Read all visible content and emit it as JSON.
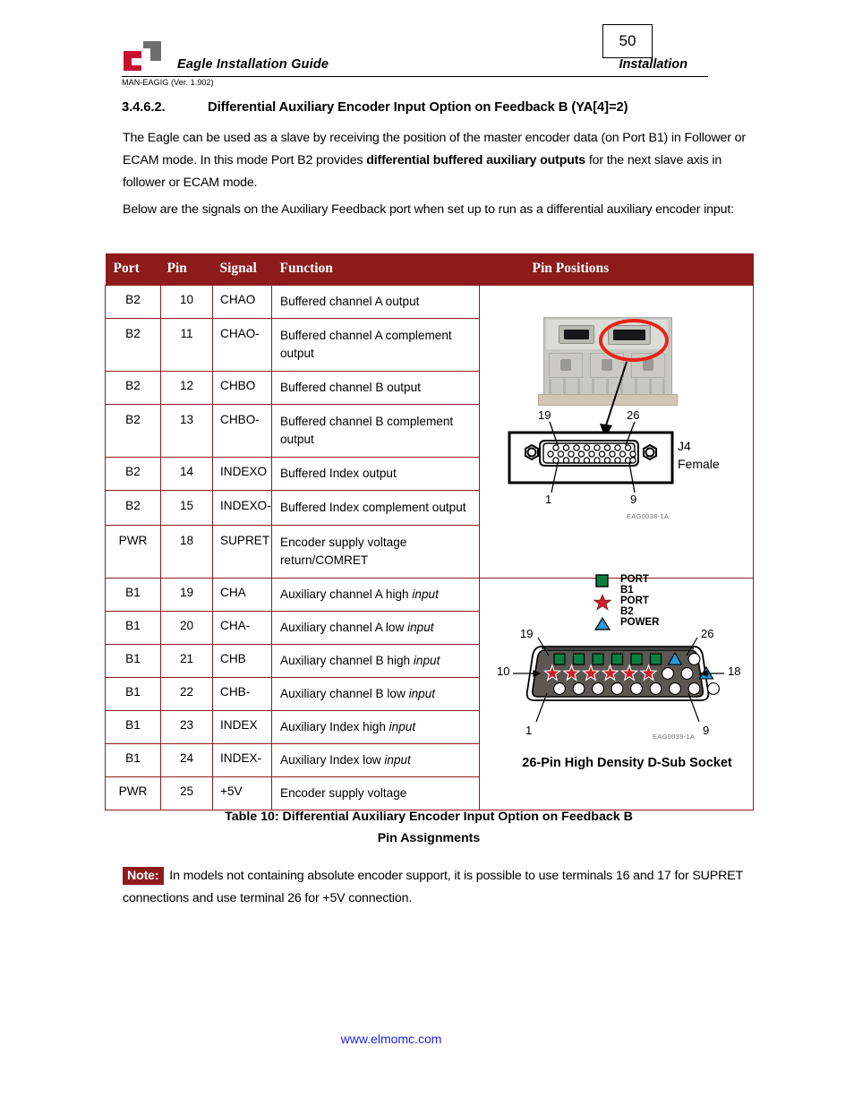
{
  "header": {
    "title": "Eagle Installation Guide",
    "doc_id": "MAN-EAGIG (Ver. 1.902)",
    "section": "Installation",
    "page_number": "50",
    "logo_name": "elmo-logo"
  },
  "section": {
    "number": "3.4.6.2.",
    "heading": "Differential Auxiliary Encoder Input Option on Feedback B (YA[4]=2)"
  },
  "paragraphs": {
    "p1_a": "The Eagle can be used as a slave by receiving the position of the master encoder data (on Port B1) in Follower or ECAM mode. In this mode Port B2 provides ",
    "p1_bold": "differential buffered auxiliary outputs",
    "p1_b": " for the next slave axis in follower or ECAM mode.",
    "p2": "Below are the signals on the Auxiliary Feedback port when set up to run as a differential auxiliary encoder input:"
  },
  "table": {
    "headers": {
      "port": "Port",
      "pin": "Pin",
      "signal": "Signal",
      "function": "Function",
      "pin_positions": "Pin Positions"
    },
    "header_bg": "#8E1B1B",
    "border_color": "#8E1B1B",
    "rows": [
      {
        "port": "B2",
        "pin": "10",
        "signal": "CHAO",
        "function": "Buffered channel A output",
        "italic": ""
      },
      {
        "port": "B2",
        "pin": "11",
        "signal": "CHAO-",
        "function": "Buffered channel A complement output",
        "italic": ""
      },
      {
        "port": "B2",
        "pin": "12",
        "signal": "CHBO",
        "function": "Buffered channel B output",
        "italic": ""
      },
      {
        "port": "B2",
        "pin": "13",
        "signal": "CHBO-",
        "function": "Buffered channel B complement output",
        "italic": ""
      },
      {
        "port": "B2",
        "pin": "14",
        "signal": "INDEXO",
        "function": "Buffered Index output",
        "italic": ""
      },
      {
        "port": "B2",
        "pin": "15",
        "signal": "INDEXO-",
        "function": "Buffered Index complement output",
        "italic": ""
      },
      {
        "port": "PWR",
        "pin": "18",
        "signal": "SUPRET",
        "function": "Encoder supply voltage return/COMRET",
        "italic": ""
      },
      {
        "port": "B1",
        "pin": "19",
        "signal": "CHA",
        "function": "Auxiliary channel A high ",
        "italic": "input"
      },
      {
        "port": "B1",
        "pin": "20",
        "signal": "CHA-",
        "function": "Auxiliary channel A low ",
        "italic": "input"
      },
      {
        "port": "B1",
        "pin": "21",
        "signal": "CHB",
        "function": "Auxiliary channel B high ",
        "italic": "input"
      },
      {
        "port": "B1",
        "pin": "22",
        "signal": "CHB-",
        "function": "Auxiliary channel B low ",
        "italic": "input"
      },
      {
        "port": "B1",
        "pin": "23",
        "signal": "INDEX",
        "function": "Auxiliary Index high ",
        "italic": "input"
      },
      {
        "port": "B1",
        "pin": "24",
        "signal": "INDEX-",
        "function": "Auxiliary Index low ",
        "italic": "input"
      },
      {
        "port": "PWR",
        "pin": "25",
        "signal": "+5V",
        "function": "Encoder supply voltage",
        "italic": ""
      }
    ]
  },
  "diagram_top": {
    "name": "j4-connector-diagram",
    "connector_label_line1": "J4",
    "connector_label_line2": "Female",
    "pin_top_left": "19",
    "pin_top_right": "26",
    "pin_bottom_left": "1",
    "pin_bottom_right": "9",
    "ref_code": "EAG0038-1A",
    "highlight_color": "#e8231a"
  },
  "diagram_bottom": {
    "name": "pin-position-map",
    "legend": [
      {
        "label": "PORT B1",
        "marker": "square-icon",
        "color": "#0A8040"
      },
      {
        "label": "PORT B2",
        "marker": "star-icon",
        "color": "#CC2229"
      },
      {
        "label": "POWER",
        "marker": "triangle-icon",
        "color": "#2B9AD6"
      }
    ],
    "pin_top_left": "19",
    "pin_top_right": "26",
    "pin_mid_left": "10",
    "pin_mid_right": "18",
    "pin_bottom_left": "1",
    "pin_bottom_right": "9",
    "ref_code": "EAG0039-1A",
    "caption": "26-Pin High Density D-Sub Socket",
    "shell_color": "#5B5853",
    "rows": [
      {
        "markers": [
          "square",
          "square",
          "square",
          "square",
          "square",
          "square",
          "triangle",
          "circle"
        ]
      },
      {
        "markers": [
          "star",
          "star",
          "star",
          "star",
          "star",
          "star",
          "circle",
          "circle",
          "triangle"
        ]
      },
      {
        "markers": [
          "circle",
          "circle",
          "circle",
          "circle",
          "circle",
          "circle",
          "circle",
          "circle",
          "circle"
        ]
      }
    ]
  },
  "caption": {
    "line1": "Table 10: Differential Auxiliary Encoder Input Option on Feedback B",
    "line2": "Pin Assignments"
  },
  "note": {
    "badge": "Note:",
    "text": " In models not containing absolute encoder support, it is possible to use terminals 16 and 17 for SUPRET connections and use terminal 26 for +5V connection."
  },
  "footer": {
    "url": "www.elmomc.com"
  }
}
